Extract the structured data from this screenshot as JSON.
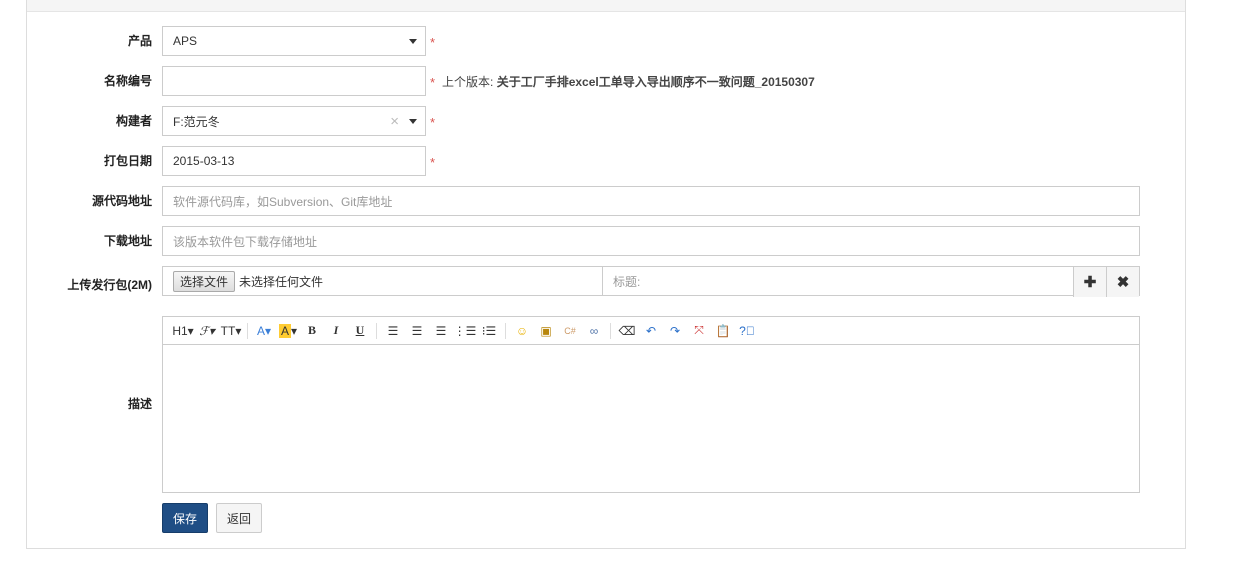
{
  "form": {
    "product": {
      "label": "产品",
      "value": "APS"
    },
    "name": {
      "label": "名称编号",
      "value": "",
      "hint_prefix": "上个版本:",
      "hint_value": "关于工厂手排excel工单导入导出顺序不一致问题_20150307"
    },
    "builder": {
      "label": "构建者",
      "value": "F:范元冬"
    },
    "date": {
      "label": "打包日期",
      "value": "2015-03-13"
    },
    "source": {
      "label": "源代码地址",
      "placeholder": "软件源代码库，如Subversion、Git库地址"
    },
    "download": {
      "label": "下载地址",
      "placeholder": "该版本软件包下载存储地址"
    },
    "upload": {
      "label": "上传发行包(2M)",
      "choose_button": "选择文件",
      "no_file": "未选择任何文件",
      "title_placeholder": "标题:"
    },
    "description": {
      "label": "描述",
      "toolbar": [
        "H1",
        "ℱ",
        "TT",
        "A",
        "A",
        "B",
        "I",
        "U"
      ]
    },
    "required_mark": "*"
  },
  "buttons": {
    "save": "保存",
    "back": "返回"
  },
  "colors": {
    "primary": "#1f4e85",
    "required": "#d9534f"
  }
}
